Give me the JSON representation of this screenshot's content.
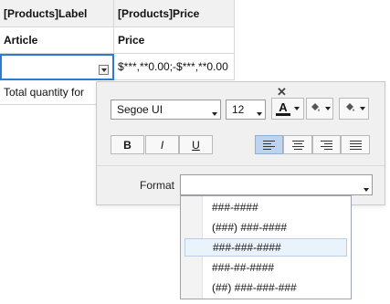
{
  "grid": {
    "headers": [
      "[Products]Label",
      "[Products]Price"
    ],
    "row2": [
      "Article",
      "Price"
    ],
    "row3_col2": "$***,**0.00;-$***,**0.00",
    "row4_col1": "Total quantity for"
  },
  "toolbar": {
    "font_family": "Segoe UI",
    "font_size": "12",
    "text_color_letter": "A",
    "bold_label": "B",
    "italic_label": "I",
    "underline_label": "U",
    "colors": {
      "text": "#1a1a1a",
      "fill_active_align": "#bcd4ef"
    }
  },
  "format": {
    "label": "Format",
    "value": "",
    "options": [
      "###-####",
      "(###) ###-####",
      "###-###-####",
      "###-##-####",
      "(##) ###-###-###"
    ],
    "highlighted_index": 2
  }
}
